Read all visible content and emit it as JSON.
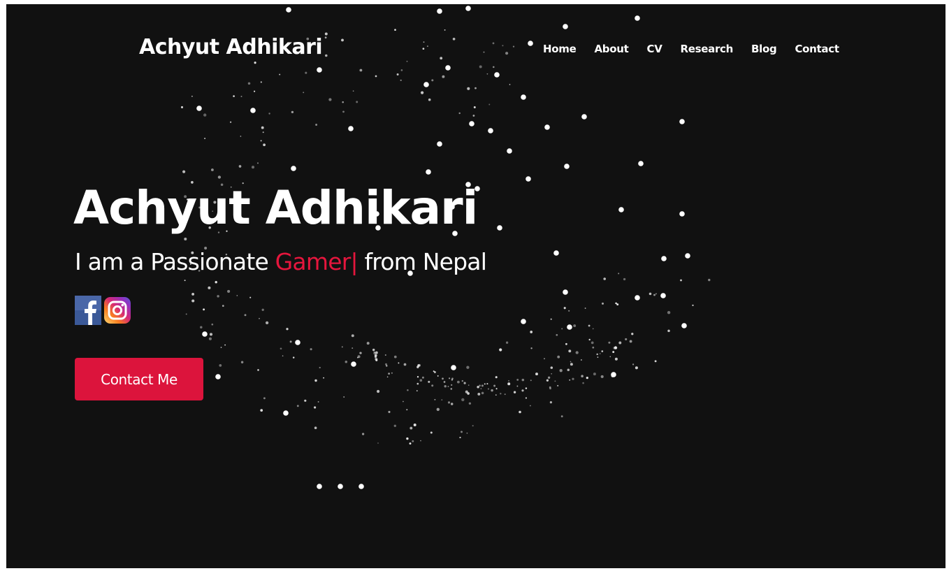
{
  "header": {
    "brand": "Achyut Adhikari",
    "nav": [
      "Home",
      "About",
      "CV",
      "Research",
      "Blog",
      "Contact"
    ]
  },
  "hero": {
    "title": "Achyut Adhikari",
    "subtitle_prefix": "I am a Passionate ",
    "subtitle_typed": "Gamer|",
    "subtitle_suffix": " from Nepal",
    "socials": [
      {
        "name": "facebook",
        "icon": "facebook-icon"
      },
      {
        "name": "instagram",
        "icon": "instagram-icon"
      }
    ],
    "button_label": "Contact Me"
  },
  "colors": {
    "background": "#111111",
    "accent": "#dc143c",
    "text": "#ffffff"
  }
}
